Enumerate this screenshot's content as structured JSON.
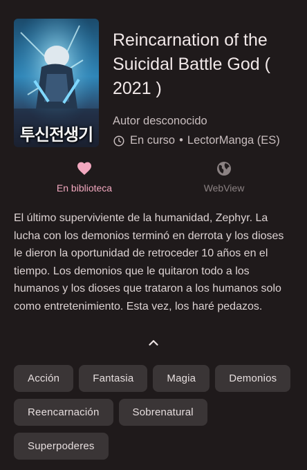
{
  "manga": {
    "title": "Reincarnation of the Suicidal Battle God ( 2021 )",
    "author": "Autor desconocido",
    "status": "En curso",
    "separator": "•",
    "source": "LectorManga (ES)",
    "cover_text": "투신전생기"
  },
  "actions": {
    "library_label": "En biblioteca",
    "webview_label": "WebView"
  },
  "description": "El último superviviente de la humanidad, Zephyr. La lucha con los demonios terminó en derrota y los dioses le dieron la oportunidad de retroceder 10 años en el tiempo. Los demonios que le quitaron todo a los humanos y los dioses que trataron a los humanos solo como entretenimiento. Esta vez, los haré pedazos.",
  "genres": [
    "Acción",
    "Fantasia",
    "Magia",
    "Demonios",
    "Reencarnación",
    "Sobrenatural",
    "Superpoderes"
  ],
  "colors": {
    "background": "#1f1a1b",
    "accent": "#f2a8bf",
    "chip": "#3a3536",
    "muted": "#8b8283"
  },
  "icons": {
    "library": "heart-icon",
    "webview": "globe-icon",
    "status": "clock-icon",
    "collapse": "chevron-up-icon"
  }
}
